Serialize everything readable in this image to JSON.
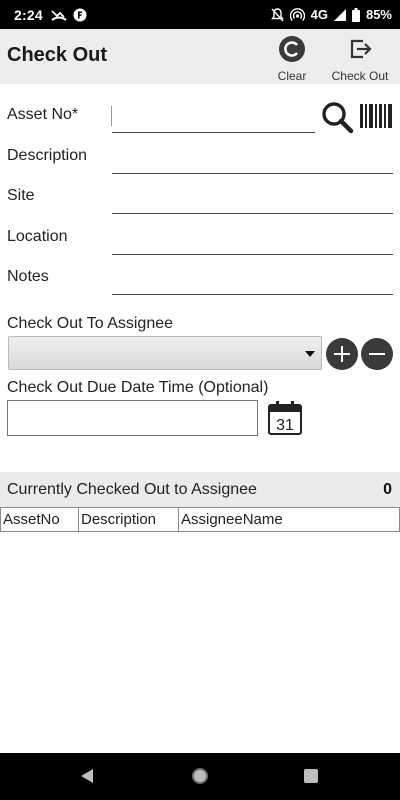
{
  "status_bar": {
    "time": "2:24",
    "network": "4G",
    "battery": "85%"
  },
  "app_bar": {
    "title": "Check Out",
    "clear_label": "Clear",
    "checkout_label": "Check Out"
  },
  "form": {
    "asset_no_label": "Asset No*",
    "asset_no_value": "",
    "description_label": "Description",
    "description_value": "",
    "site_label": "Site",
    "site_value": "",
    "location_label": "Location",
    "location_value": "",
    "notes_label": "Notes",
    "notes_value": ""
  },
  "assignee": {
    "label": "Check Out To Assignee",
    "selected": ""
  },
  "due_date": {
    "label": "Check Out Due Date Time (Optional)",
    "value": "",
    "calendar_day": "31"
  },
  "summary": {
    "label": "Currently Checked Out to Assignee",
    "count": "0"
  },
  "table": {
    "columns": [
      "AssetNo",
      "Description",
      "AssigneeName"
    ],
    "rows": []
  },
  "icons": {
    "clear": "refresh-circle-icon",
    "checkout": "exit-arrow-icon",
    "search": "search-icon",
    "barcode": "barcode-icon",
    "add": "plus-circle-icon",
    "remove": "minus-circle-icon",
    "calendar": "calendar-icon"
  },
  "colors": {
    "app_bar_bg": "#ededed",
    "summary_bg": "#ebebeb",
    "round_button": "#3a3a3a"
  }
}
